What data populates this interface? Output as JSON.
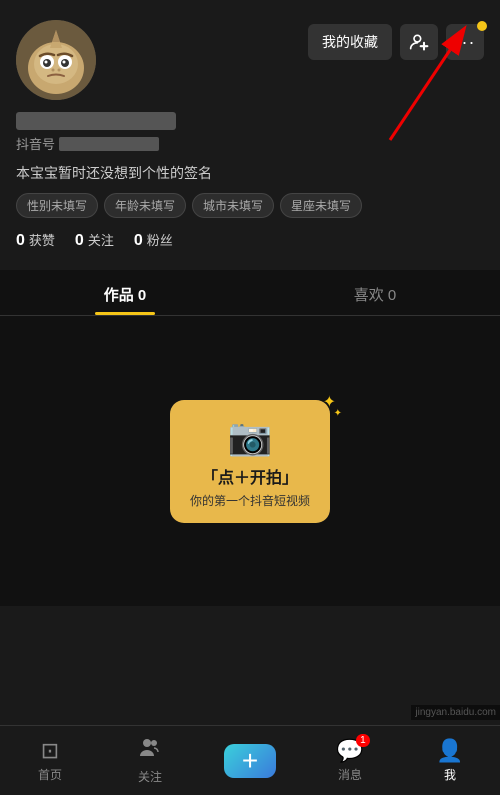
{
  "profile": {
    "avatar_alt": "monster avatar",
    "actions": {
      "favorite_label": "我的收藏",
      "add_friend_label": "➕",
      "more_label": "···"
    },
    "douyin_id_label": "抖音号",
    "bio": "本宝宝暂时还没想到个性的签名",
    "tags": [
      "性别未填写",
      "年龄未填写",
      "城市未填写",
      "星座未填写"
    ],
    "stats": [
      {
        "num": "0",
        "label": "获赞"
      },
      {
        "num": "0",
        "label": "关注"
      },
      {
        "num": "0",
        "label": "粉丝"
      }
    ]
  },
  "tabs": [
    {
      "label": "作品 0",
      "active": true
    },
    {
      "label": "喜欢 0",
      "active": false
    }
  ],
  "cta_card": {
    "title": "「点＋开拍」",
    "subtitle": "你的第一个抖音短视频"
  },
  "bottom_nav": [
    {
      "label": "首页",
      "icon": "⊡",
      "active": false
    },
    {
      "label": "关注",
      "icon": "👥",
      "active": false
    },
    {
      "label": "+",
      "icon": "+",
      "active": false
    },
    {
      "label": "消息",
      "icon": "💬",
      "active": false,
      "badge": "1"
    },
    {
      "label": "我",
      "icon": "👤",
      "active": true
    }
  ],
  "watermark": "jingyan.baidu.com"
}
